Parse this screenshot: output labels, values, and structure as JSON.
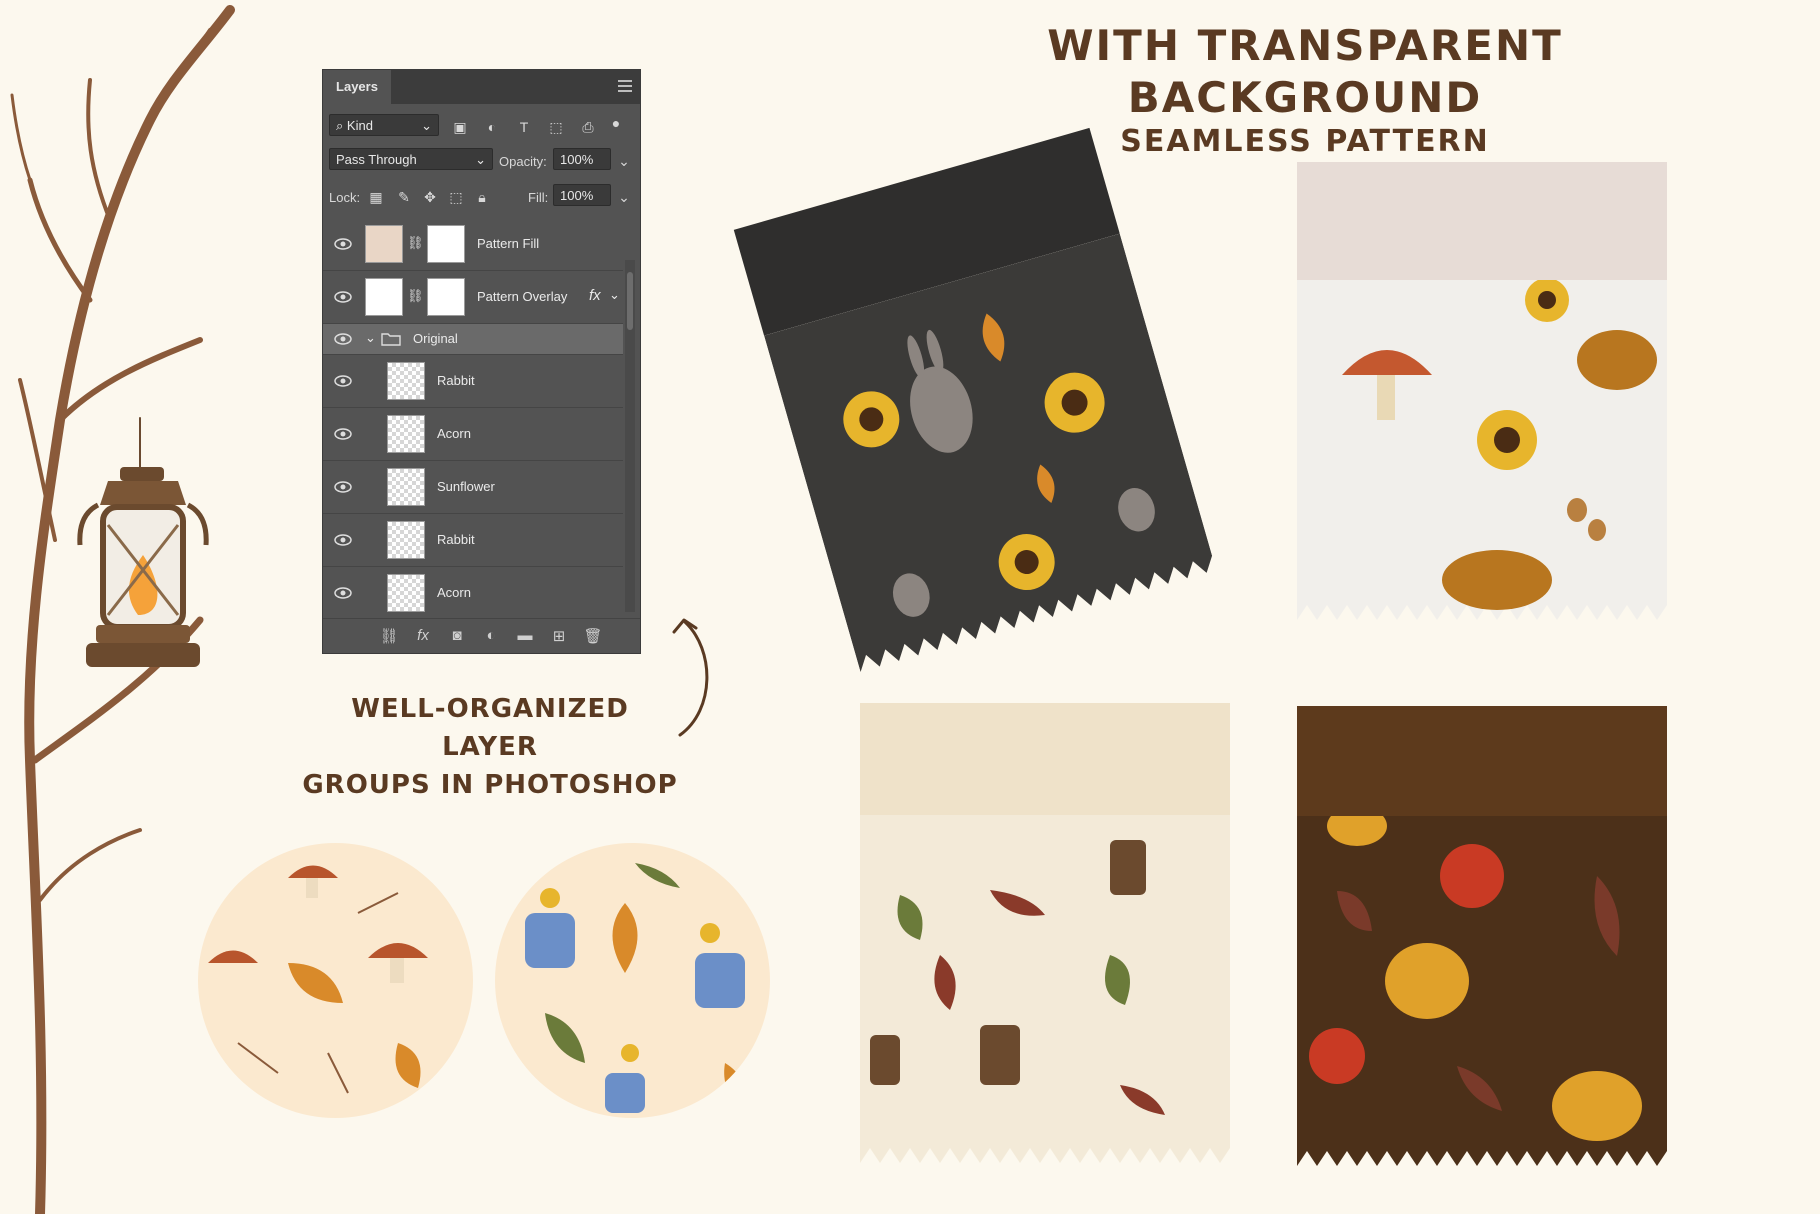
{
  "headline": {
    "line1": "WITH TRANSPARENT BACKGROUND",
    "line2": "SEAMLESS PATTERN"
  },
  "caption": {
    "line1": "WELL-ORGANIZED LAYER",
    "line2": "GROUPS IN PHOTOSHOP"
  },
  "layers_panel": {
    "tab": "Layers",
    "filter_kind": "Kind",
    "blend_mode": "Pass Through",
    "opacity_label": "Opacity:",
    "opacity_value": "100%",
    "lock_label": "Lock:",
    "fill_label": "Fill:",
    "fill_value": "100%",
    "fx_label": "fx",
    "layers": [
      {
        "name": "Pattern Fill"
      },
      {
        "name": "Pattern Overlay"
      },
      {
        "name": "Original"
      },
      {
        "name": "Rabbit"
      },
      {
        "name": "Acorn"
      },
      {
        "name": "Sunflower"
      },
      {
        "name": "Rabbit"
      },
      {
        "name": "Acorn"
      }
    ]
  },
  "swatch_colors": {
    "charcoal": "#3b3a38",
    "white": "#f1efeb",
    "cream": "#f3ead8",
    "brown": "#4c3019",
    "header_pink": "#e7dcd6",
    "header_beige": "#efe2c9",
    "header_brown": "#5d3a1c",
    "header_dark": "#2f2e2d"
  },
  "icons": [
    "eye-icon",
    "folder-icon",
    "link-icon",
    "lock-icon",
    "trash-icon",
    "lantern-icon",
    "branch-icon",
    "curved-arrow-icon"
  ]
}
